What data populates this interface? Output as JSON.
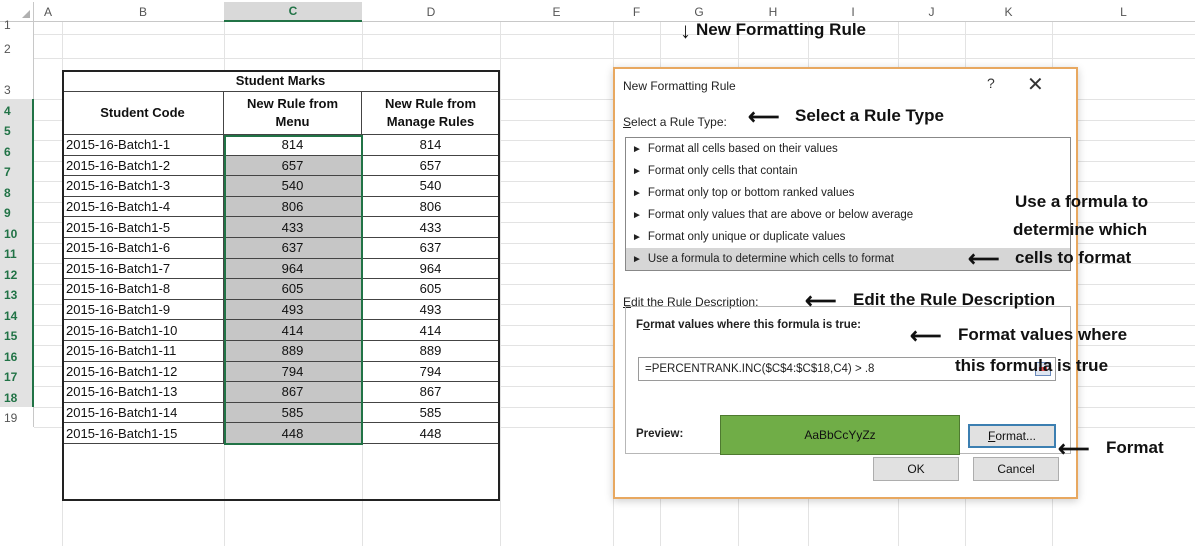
{
  "spreadsheet": {
    "columns": [
      "A",
      "B",
      "C",
      "D",
      "E",
      "F",
      "G",
      "H",
      "I",
      "J",
      "K",
      "L"
    ],
    "selected_column": "C",
    "rows": [
      "1",
      "2",
      "3",
      "4",
      "5",
      "6",
      "7",
      "8",
      "9",
      "10",
      "11",
      "12",
      "13",
      "14",
      "15",
      "16",
      "17",
      "18",
      "19"
    ],
    "table": {
      "title": "Student Marks",
      "headers": [
        "Student Code",
        "New Rule from Menu",
        "New Rule from Manage Rules"
      ],
      "header_lines": {
        "c_line1": "New Rule from",
        "c_line2": "Menu",
        "d_line1": "New Rule from",
        "d_line2": "Manage Rules"
      },
      "rows": [
        {
          "code": "2015-16-Batch1-1",
          "menu": "814",
          "manage": "814",
          "shaded": false
        },
        {
          "code": "2015-16-Batch1-2",
          "menu": "657",
          "manage": "657",
          "shaded": true
        },
        {
          "code": "2015-16-Batch1-3",
          "menu": "540",
          "manage": "540",
          "shaded": true
        },
        {
          "code": "2015-16-Batch1-4",
          "menu": "806",
          "manage": "806",
          "shaded": true
        },
        {
          "code": "2015-16-Batch1-5",
          "menu": "433",
          "manage": "433",
          "shaded": true
        },
        {
          "code": "2015-16-Batch1-6",
          "menu": "637",
          "manage": "637",
          "shaded": true
        },
        {
          "code": "2015-16-Batch1-7",
          "menu": "964",
          "manage": "964",
          "shaded": true
        },
        {
          "code": "2015-16-Batch1-8",
          "menu": "605",
          "manage": "605",
          "shaded": true
        },
        {
          "code": "2015-16-Batch1-9",
          "menu": "493",
          "manage": "493",
          "shaded": true
        },
        {
          "code": "2015-16-Batch1-10",
          "menu": "414",
          "manage": "414",
          "shaded": true
        },
        {
          "code": "2015-16-Batch1-11",
          "menu": "889",
          "manage": "889",
          "shaded": true
        },
        {
          "code": "2015-16-Batch1-12",
          "menu": "794",
          "manage": "794",
          "shaded": true
        },
        {
          "code": "2015-16-Batch1-13",
          "menu": "867",
          "manage": "867",
          "shaded": true
        },
        {
          "code": "2015-16-Batch1-14",
          "menu": "585",
          "manage": "585",
          "shaded": true
        },
        {
          "code": "2015-16-Batch1-15",
          "menu": "448",
          "manage": "448",
          "shaded": true
        }
      ]
    }
  },
  "dialog": {
    "title": "New Formatting Rule",
    "help": "?",
    "close": "✕",
    "select_rule_type_prefix": "S",
    "select_rule_type_rest": "elect a Rule Type:",
    "rule_types": [
      "Format all cells based on their values",
      "Format only cells that contain",
      "Format only top or bottom ranked values",
      "Format only values that are above or below average",
      "Format only unique or duplicate values",
      "Use a formula to determine which cells to format"
    ],
    "selected_rule_index": 5,
    "edit_description_prefix": "E",
    "edit_description_rest": "dit the Rule Description:",
    "format_values_prefix": "F",
    "format_values_o": "o",
    "format_values_rest": "rmat values where this formula is true:",
    "formula": "=PERCENTRANK.INC($C$4:$C$18,C4) > .8",
    "preview_label": "Preview:",
    "preview_text": "AaBbCcYyZz",
    "preview_color": "#70ad47",
    "format_button_prefix": "F",
    "format_button_rest": "ormat...",
    "ok_label": "OK",
    "cancel_label": "Cancel"
  },
  "annotations": {
    "new_formatting_rule": "New Formatting Rule",
    "select_rule_type": "Select a Rule Type",
    "use_formula_1": "Use a formula to",
    "use_formula_2": "determine which",
    "use_formula_3": "cells to format",
    "edit_rule_description": "Edit the Rule Description",
    "format_values_1": "Format values where",
    "format_values_2": "this formula is true",
    "format": "Format"
  },
  "colors": {
    "excel_green": "#217346",
    "dialog_border": "#e8a860",
    "shaded_cell": "#c6c6c6"
  }
}
